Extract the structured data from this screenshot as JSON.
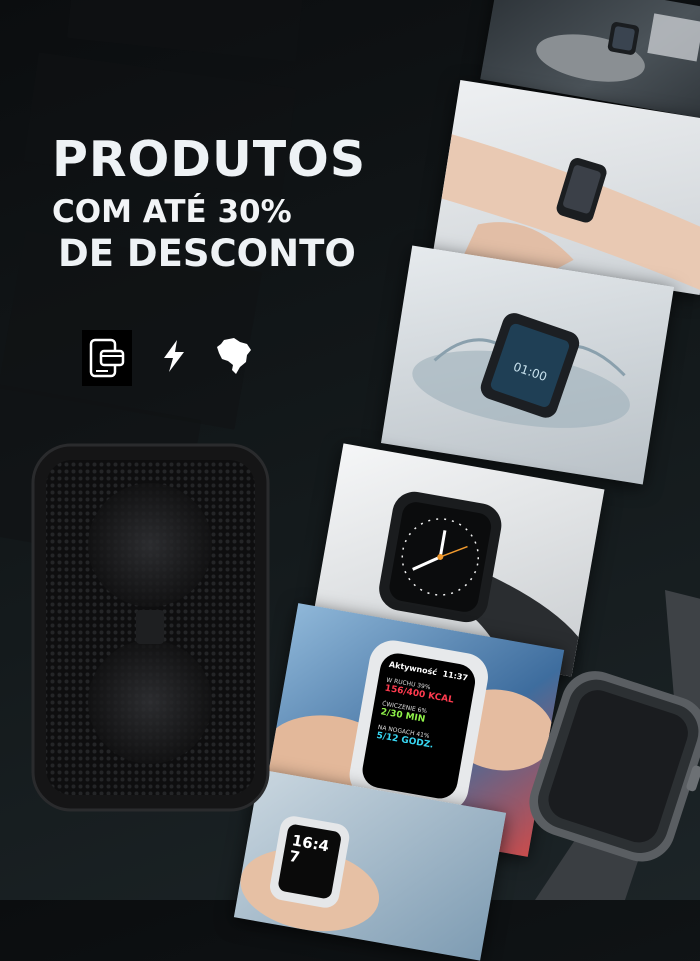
{
  "headline": {
    "line1": "PRODUTOS",
    "line2": "COM ATÉ 30%",
    "line3": "DE DESCONTO"
  },
  "feature_icons": [
    "payment-card-icon",
    "lightning-bolt-icon",
    "brazil-map-icon"
  ],
  "watch_screen": {
    "title": "Aktywność",
    "time": "11:37",
    "rows": [
      {
        "label": "W RUCHU 39%",
        "value": "156/400 KCAL",
        "color": "#ff3b4f"
      },
      {
        "label": "ĆWICZENIE 6%",
        "value": "2/30 MIN",
        "color": "#8ff24a"
      },
      {
        "label": "NA NOGACH 41%",
        "value": "5/12 GODZ.",
        "color": "#38d6f2"
      }
    ]
  },
  "bottom_watch_time": "16:47",
  "colors": {
    "background": "#111517",
    "text": "#eef2f5"
  }
}
